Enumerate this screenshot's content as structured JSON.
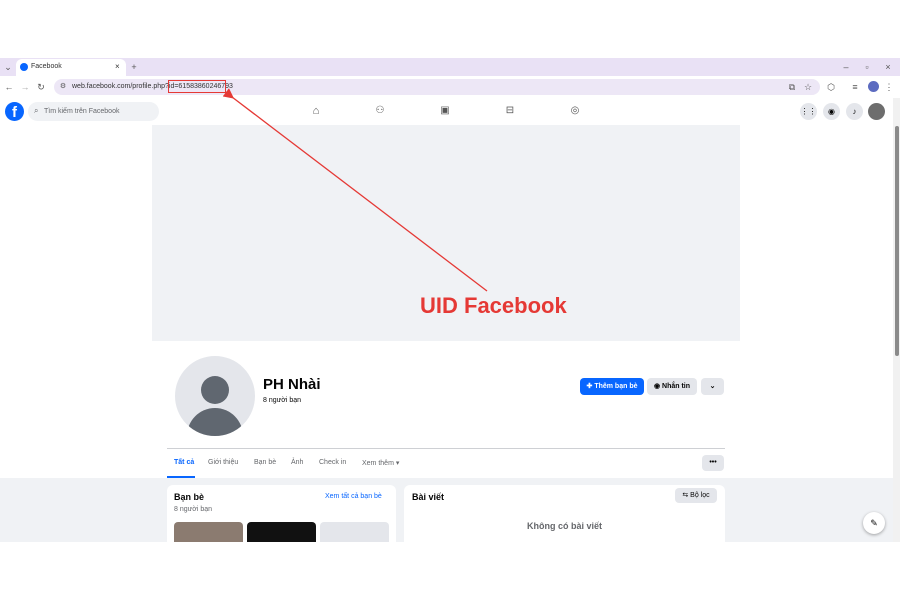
{
  "browser": {
    "tab_title": "Facebook",
    "new_tab": "+",
    "url": "web.facebook.com/profile.php?id=61583860246793",
    "window_controls": [
      "–",
      "▫",
      "×"
    ]
  },
  "annotation": {
    "label": "UID Facebook",
    "color": "#e53935"
  },
  "fb": {
    "search_placeholder": "Tìm kiếm trên Facebook",
    "brand_color": "#0866ff"
  },
  "profile": {
    "name": "PH Nhài",
    "friends_count": "8 người bạn",
    "add_friend": "Thêm bạn bè",
    "message": "Nhắn tin",
    "more": "⌄"
  },
  "tabs": [
    "Tất cả",
    "Giới thiệu",
    "Bạn bè",
    "Ảnh",
    "Check in",
    "Xem thêm"
  ],
  "tabs_more_icon": "•••",
  "friends_card": {
    "title": "Bạn bè",
    "see_all": "Xem tất cả bạn bè",
    "count": "8 người bạn"
  },
  "posts_card": {
    "title": "Bài viết",
    "filter": "Bộ lọc",
    "empty": "Không có bài viết"
  }
}
